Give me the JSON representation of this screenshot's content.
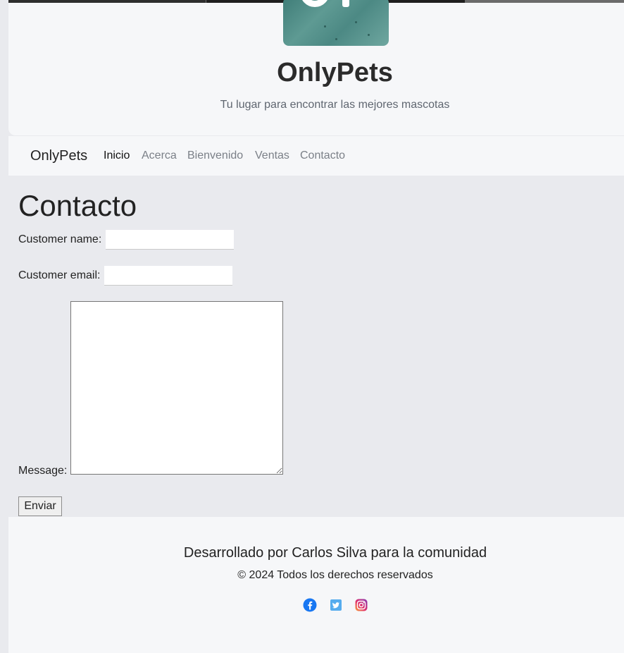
{
  "hero": {
    "title": "OnlyPets",
    "subtitle": "Tu lugar para encontrar las mejores mascotas"
  },
  "navbar": {
    "brand": "OnlyPets",
    "items": [
      {
        "label": "Inicio",
        "active": true
      },
      {
        "label": "Acerca",
        "active": false
      },
      {
        "label": "Bienvenido",
        "active": false
      },
      {
        "label": "Ventas",
        "active": false
      },
      {
        "label": "Contacto",
        "active": false
      }
    ]
  },
  "contact": {
    "title": "Contacto",
    "name_label": "Customer name:",
    "name_value": "",
    "email_label": "Customer email:",
    "email_value": "",
    "message_label": "Message:",
    "message_value": "",
    "submit_label": "Enviar"
  },
  "footer": {
    "developer": "Desarrollado por Carlos Silva para la comunidad",
    "copyright": "© 2024 Todos los derechos reservados",
    "social_icons": [
      "facebook-icon",
      "twitter-icon",
      "instagram-icon"
    ]
  },
  "colors": {
    "page_background": "#e9eaee",
    "panel_background": "#f6f7f9",
    "nav_inactive": "#7b8088",
    "facebook": "#1877f2",
    "twitter": "#55acee"
  }
}
